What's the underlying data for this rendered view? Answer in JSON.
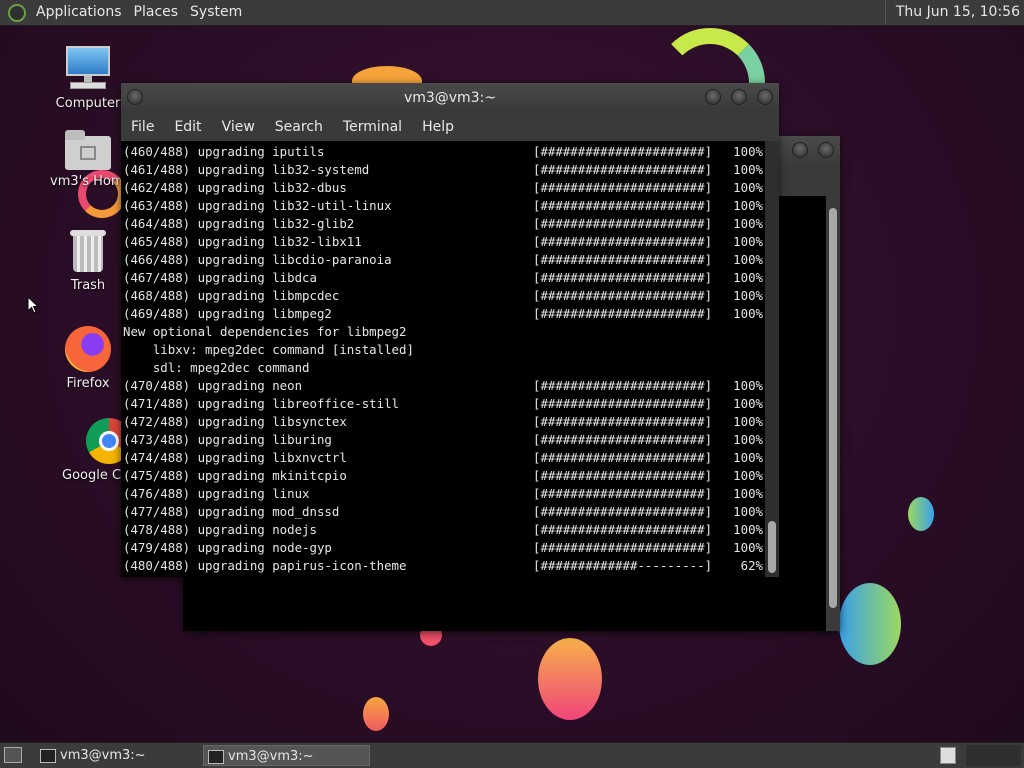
{
  "top_panel": {
    "menus": [
      "Applications",
      "Places",
      "System"
    ],
    "clock": "Thu Jun 15, 10:56"
  },
  "desktop_icons": [
    {
      "label": "Computer",
      "icon": "computer-icon"
    },
    {
      "label": "vm3's Home",
      "icon": "home-folder-icon"
    },
    {
      "label": "Trash",
      "icon": "trash-icon"
    },
    {
      "label": "Firefox",
      "icon": "firefox-icon"
    },
    {
      "label": "Google C",
      "icon": "chrome-icon"
    }
  ],
  "terminal": {
    "title": "vm3@vm3:~",
    "menu": [
      "File",
      "Edit",
      "View",
      "Search",
      "Terminal",
      "Help"
    ],
    "lines": [
      {
        "text": "(460/488) upgrading iputils",
        "bar": "[######################]",
        "pct": "100%"
      },
      {
        "text": "(461/488) upgrading lib32-systemd",
        "bar": "[######################]",
        "pct": "100%"
      },
      {
        "text": "(462/488) upgrading lib32-dbus",
        "bar": "[######################]",
        "pct": "100%"
      },
      {
        "text": "(463/488) upgrading lib32-util-linux",
        "bar": "[######################]",
        "pct": "100%"
      },
      {
        "text": "(464/488) upgrading lib32-glib2",
        "bar": "[######################]",
        "pct": "100%"
      },
      {
        "text": "(465/488) upgrading lib32-libx11",
        "bar": "[######################]",
        "pct": "100%"
      },
      {
        "text": "(466/488) upgrading libcdio-paranoia",
        "bar": "[######################]",
        "pct": "100%"
      },
      {
        "text": "(467/488) upgrading libdca",
        "bar": "[######################]",
        "pct": "100%"
      },
      {
        "text": "(468/488) upgrading libmpcdec",
        "bar": "[######################]",
        "pct": "100%"
      },
      {
        "text": "(469/488) upgrading libmpeg2",
        "bar": "[######################]",
        "pct": "100%"
      },
      {
        "text": "New optional dependencies for libmpeg2",
        "bar": "",
        "pct": ""
      },
      {
        "text": "    libxv: mpeg2dec command [installed]",
        "bar": "",
        "pct": ""
      },
      {
        "text": "    sdl: mpeg2dec command",
        "bar": "",
        "pct": ""
      },
      {
        "text": "(470/488) upgrading neon",
        "bar": "[######################]",
        "pct": "100%"
      },
      {
        "text": "(471/488) upgrading libreoffice-still",
        "bar": "[######################]",
        "pct": "100%"
      },
      {
        "text": "(472/488) upgrading libsynctex",
        "bar": "[######################]",
        "pct": "100%"
      },
      {
        "text": "(473/488) upgrading liburing",
        "bar": "[######################]",
        "pct": "100%"
      },
      {
        "text": "(474/488) upgrading libxnvctrl",
        "bar": "[######################]",
        "pct": "100%"
      },
      {
        "text": "(475/488) upgrading mkinitcpio",
        "bar": "[######################]",
        "pct": "100%"
      },
      {
        "text": "(476/488) upgrading linux",
        "bar": "[######################]",
        "pct": "100%"
      },
      {
        "text": "(477/488) upgrading mod_dnssd",
        "bar": "[######################]",
        "pct": "100%"
      },
      {
        "text": "(478/488) upgrading nodejs",
        "bar": "[######################]",
        "pct": "100%"
      },
      {
        "text": "(479/488) upgrading node-gyp",
        "bar": "[######################]",
        "pct": "100%"
      },
      {
        "text": "(480/488) upgrading papirus-icon-theme",
        "bar": "[#############---------]",
        "pct": "62%"
      }
    ]
  },
  "taskbar": {
    "tasks": [
      {
        "label": "vm3@vm3:~",
        "active": false
      },
      {
        "label": "vm3@vm3:~",
        "active": true
      }
    ]
  },
  "colors": {
    "panel": "#3b3b3b",
    "terminal_bg": "#000000",
    "terminal_fg": "#e6e6e6",
    "desktop_bg": "#2b0d27"
  }
}
